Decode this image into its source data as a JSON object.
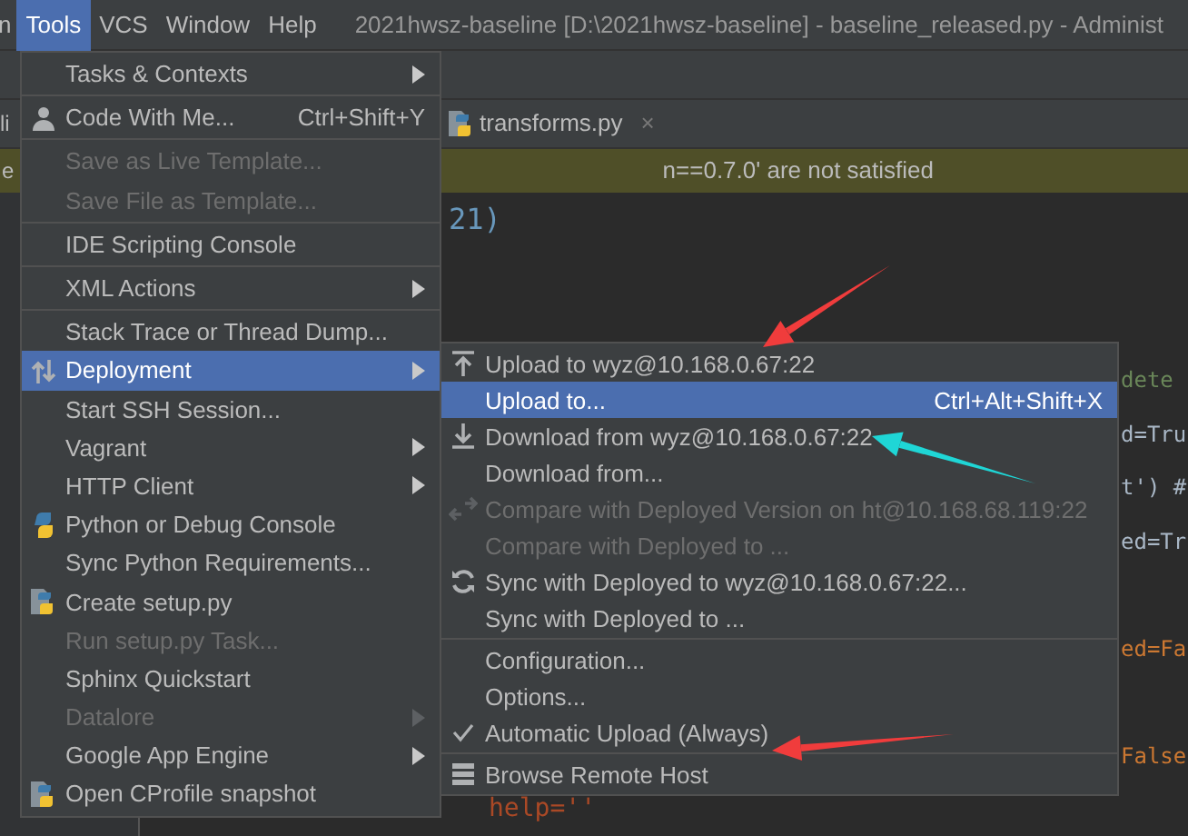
{
  "menu_bar": {
    "items": [
      {
        "label": "n",
        "selected": false
      },
      {
        "label": "Tools",
        "selected": true
      },
      {
        "label": "VCS",
        "selected": false
      },
      {
        "label": "Window",
        "selected": false
      },
      {
        "label": "Help",
        "selected": false
      }
    ],
    "title": "2021hwsz-baseline [D:\\2021hwsz-baseline] - baseline_released.py - Administ"
  },
  "tabs": [
    {
      "label": "li",
      "kind": "plain",
      "selected": false
    },
    {
      "label": "transforms.py",
      "kind": "python",
      "selected": false,
      "close": "×"
    }
  ],
  "warning_bar": {
    "left": "e",
    "text": "n==0.7.0' are not satisfied"
  },
  "editor": {
    "lines": [
      {
        "text": "21)",
        "kind": "near",
        "color": "#6897bb"
      },
      {
        "text": "dete",
        "kind": "far",
        "color": "#6a8759"
      },
      {
        "text": "d=Tru",
        "kind": "far",
        "color": "#a9b7c6"
      },
      {
        "text": "t') #",
        "kind": "far",
        "color": "#a9b7c6"
      },
      {
        "text": "ed=Tr",
        "kind": "far",
        "color": "#a9b7c6"
      },
      {
        "text": "ed=Fa",
        "kind": "far",
        "color": "#cc7832"
      },
      {
        "text": "False",
        "kind": "far",
        "color": "#cc7832"
      },
      {
        "text": "help=''",
        "kind": "mid",
        "color": "#aa4926"
      }
    ]
  },
  "tools_menu": {
    "items": [
      {
        "label": "Tasks & Contexts",
        "submenu": true,
        "disabled": false,
        "selected": false
      },
      {
        "kind": "separator"
      },
      {
        "label": "Code With Me...",
        "shortcut": "Ctrl+Shift+Y",
        "submenu": false,
        "disabled": false,
        "selected": false
      },
      {
        "kind": "separator"
      },
      {
        "label": "Save as Live Template...",
        "submenu": false,
        "disabled": true,
        "selected": false
      },
      {
        "label": "Save File as Template...",
        "submenu": false,
        "disabled": true,
        "selected": false
      },
      {
        "kind": "separator"
      },
      {
        "label": "IDE Scripting Console",
        "submenu": false,
        "disabled": false,
        "selected": false
      },
      {
        "kind": "separator"
      },
      {
        "label": "XML Actions",
        "submenu": true,
        "disabled": false,
        "selected": false
      },
      {
        "kind": "separator"
      },
      {
        "label": "Stack Trace or Thread Dump...",
        "submenu": false,
        "disabled": false,
        "selected": false
      },
      {
        "label": "Deployment",
        "submenu": true,
        "disabled": false,
        "selected": true
      },
      {
        "label": "Start SSH Session...",
        "submenu": false,
        "disabled": false,
        "selected": false
      },
      {
        "label": "Vagrant",
        "submenu": true,
        "disabled": false,
        "selected": false
      },
      {
        "label": "HTTP Client",
        "submenu": true,
        "disabled": false,
        "selected": false
      },
      {
        "label": "Python or Debug Console",
        "submenu": false,
        "disabled": false,
        "selected": false
      },
      {
        "label": "Sync Python Requirements...",
        "submenu": false,
        "disabled": false,
        "selected": false
      },
      {
        "label": "Create setup.py",
        "submenu": false,
        "disabled": false,
        "selected": false
      },
      {
        "label": "Run setup.py Task...",
        "submenu": false,
        "disabled": true,
        "selected": false
      },
      {
        "label": "Sphinx Quickstart",
        "submenu": false,
        "disabled": false,
        "selected": false
      },
      {
        "label": "Datalore",
        "submenu": true,
        "disabled": true,
        "selected": false
      },
      {
        "label": "Google App Engine",
        "submenu": true,
        "disabled": false,
        "selected": false
      },
      {
        "label": "Open CProfile snapshot",
        "submenu": false,
        "disabled": false,
        "selected": false
      }
    ]
  },
  "deployment_menu": {
    "items": [
      {
        "label": "Upload to wyz@10.168.0.67:22",
        "disabled": false,
        "selected": false,
        "checked": false
      },
      {
        "label": "Upload to...",
        "shortcut": "Ctrl+Alt+Shift+X",
        "disabled": false,
        "selected": true,
        "checked": false
      },
      {
        "label": "Download from wyz@10.168.0.67:22",
        "disabled": false,
        "selected": false,
        "checked": false
      },
      {
        "label": "Download from...",
        "disabled": false,
        "selected": false,
        "checked": false
      },
      {
        "label": "Compare with Deployed Version on ht@10.168.68.119:22",
        "disabled": true,
        "selected": false,
        "checked": false
      },
      {
        "label": "Compare with Deployed to ...",
        "disabled": true,
        "selected": false,
        "checked": false
      },
      {
        "label": "Sync with Deployed to wyz@10.168.0.67:22...",
        "disabled": false,
        "selected": false,
        "checked": false
      },
      {
        "label": "Sync with Deployed to ...",
        "disabled": false,
        "selected": false,
        "checked": false
      },
      {
        "kind": "separator"
      },
      {
        "label": "Configuration...",
        "disabled": false,
        "selected": false,
        "checked": false
      },
      {
        "label": "Options...",
        "disabled": false,
        "selected": false,
        "checked": false
      },
      {
        "label": "Automatic Upload (Always)",
        "disabled": false,
        "selected": false,
        "checked": true
      },
      {
        "kind": "separator"
      },
      {
        "label": "Browse Remote Host",
        "disabled": false,
        "selected": false,
        "checked": false
      }
    ]
  },
  "annotations": [
    {
      "color": "#f03c3c"
    },
    {
      "color": "#1fd6d6"
    },
    {
      "color": "#f03c3c"
    }
  ]
}
